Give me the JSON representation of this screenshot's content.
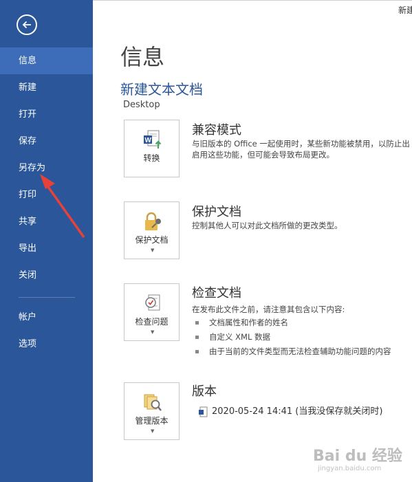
{
  "titlebar": {
    "text": "新建"
  },
  "sidebar": {
    "back_icon": "back-arrow-icon",
    "items": [
      {
        "label": "信息",
        "active": true
      },
      {
        "label": "新建"
      },
      {
        "label": "打开"
      },
      {
        "label": "保存"
      },
      {
        "label": "另存为"
      },
      {
        "label": "打印"
      },
      {
        "label": "共享"
      },
      {
        "label": "导出"
      },
      {
        "label": "关闭"
      }
    ],
    "bottom_items": [
      {
        "label": "帐户"
      },
      {
        "label": "选项"
      }
    ]
  },
  "main": {
    "page_title": "信息",
    "doc_title": "新建文本文档",
    "doc_path": "Desktop",
    "sections": [
      {
        "tile_label": "转换",
        "tile_icon": "word-convert-icon",
        "heading": "兼容模式",
        "desc_lines": [
          "与旧版本的 Office 一起使用时，某些新功能被禁用，以防止出",
          "启用这些功能，但可能会导致布局更改。"
        ]
      },
      {
        "tile_label": "保护文档",
        "tile_icon": "lock-key-icon",
        "heading": "保护文档",
        "desc_lines": [
          "控制其他人可以对此文档所做的更改类型。"
        ]
      },
      {
        "tile_label": "检查问题",
        "tile_icon": "inspect-document-icon",
        "heading": "检查文档",
        "desc_lines": [
          "在发布此文件之前，请注意其包含以下内容:"
        ],
        "bullets": [
          "文档属性和作者的姓名",
          "自定义 XML 数据",
          "由于当前的文件类型而无法检查辅助功能问题的内容"
        ]
      },
      {
        "tile_label": "管理版本",
        "tile_icon": "manage-versions-icon",
        "heading": "版本",
        "version_entry": "2020-05-24 14:41 (当我没保存就关闭时)"
      }
    ]
  },
  "watermark": {
    "text": "Bai du 经验",
    "sub": "jingyan.baidu.com"
  },
  "colors": {
    "sidebar": "#2b579a",
    "active": "#3d6db8",
    "accent": "#2b579a",
    "arrow": "#e8413a"
  }
}
